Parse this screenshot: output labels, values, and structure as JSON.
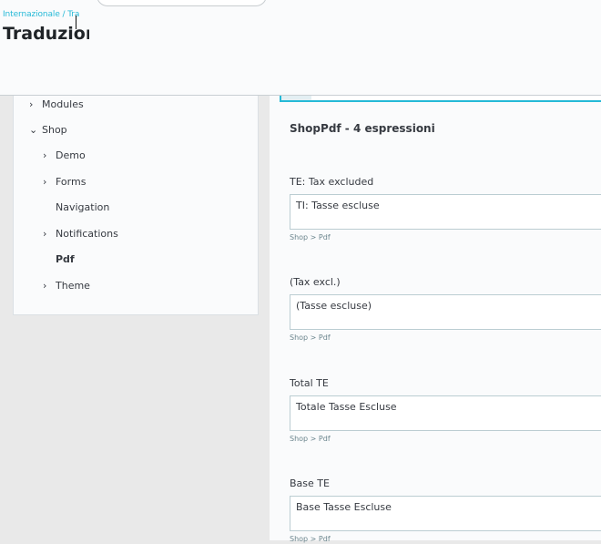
{
  "header": {
    "breadcrumb": "Internazionale / Tra",
    "title": "Traduzioni"
  },
  "tree": {
    "items": [
      {
        "label": "Modules",
        "expanded": false,
        "has_children": true
      },
      {
        "label": "Shop",
        "expanded": true,
        "has_children": true
      },
      {
        "label": "Demo",
        "expanded": false,
        "has_children": true
      },
      {
        "label": "Forms",
        "expanded": false,
        "has_children": true
      },
      {
        "label": "Navigation",
        "expanded": false,
        "has_children": false
      },
      {
        "label": "Notifications",
        "expanded": false,
        "has_children": true
      },
      {
        "label": "Pdf",
        "expanded": false,
        "has_children": false,
        "active": true
      },
      {
        "label": "Theme",
        "expanded": false,
        "has_children": true
      }
    ]
  },
  "main": {
    "section_title": "ShopPdf - 4 espressioni",
    "entries": [
      {
        "label": "TE: Tax excluded",
        "value": "TI: Tasse escluse",
        "path": "Shop > Pdf"
      },
      {
        "label": "(Tax excl.)",
        "value": "(Tasse escluse)",
        "path": "Shop > Pdf"
      },
      {
        "label": "Total TE",
        "value": "Totale Tasse Escluse",
        "path": "Shop > Pdf"
      },
      {
        "label": "Base TE",
        "value": "Base Tasse Escluse",
        "path": "Shop > Pdf"
      }
    ]
  },
  "colors": {
    "accent": "#25b9d7",
    "text": "#363a41",
    "panel_bg": "#fafbfc",
    "page_bg": "#e9e9e9"
  },
  "icons": {
    "collapsed": "chevron-right-icon",
    "expanded": "chevron-down-icon"
  }
}
